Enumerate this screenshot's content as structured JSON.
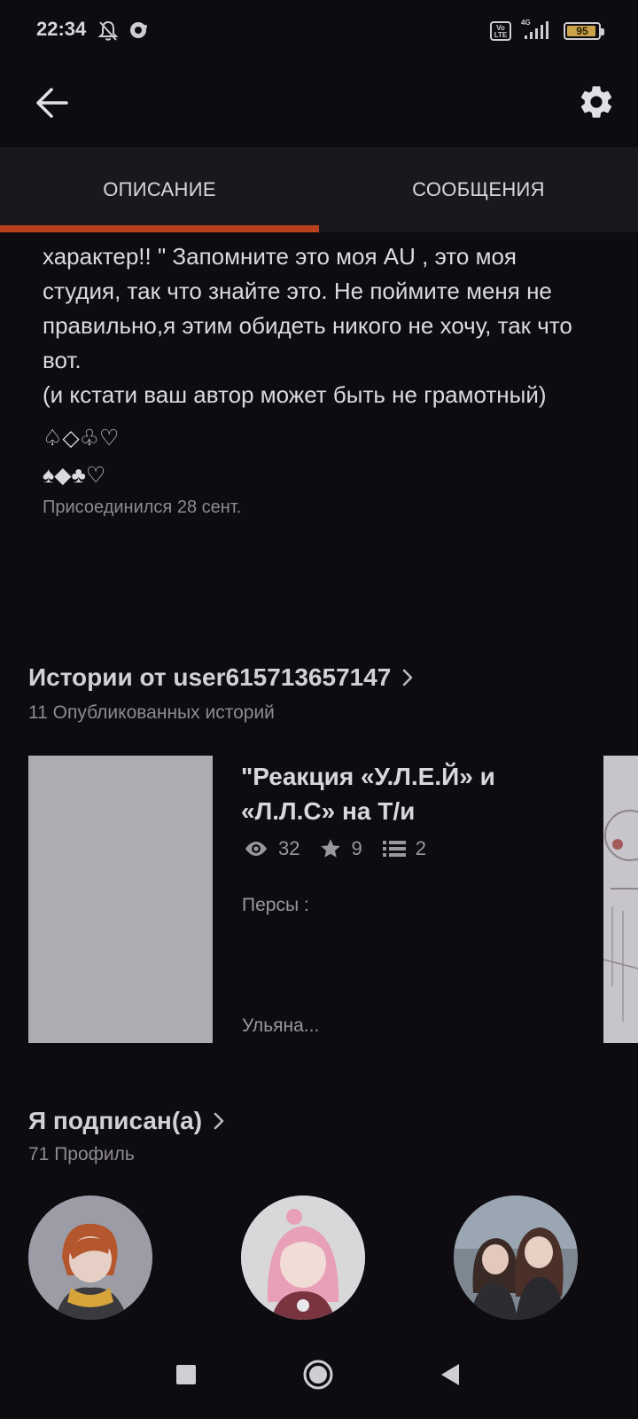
{
  "status_bar": {
    "time": "22:34",
    "battery": "95",
    "battery_level": 0.95,
    "network": "4G",
    "volte": "Vo LTE"
  },
  "toolbar": {
    "back_icon": "arrow-left-icon",
    "settings_icon": "gear-icon"
  },
  "tabs": [
    {
      "label": "ОПИСАНИЕ",
      "active": true
    },
    {
      "label": "СООБЩЕНИЯ",
      "active": false
    }
  ],
  "accent_color": "#b8411c",
  "description": {
    "text": "характер!! \" Запомните это моя AU , это моя студия, так что знайте это. Не поймите меня не правильно,я этим обидеть никого не хочу, так что вот.\n(и кстати ваш автор может быть не грамотный)",
    "suits_outline": "♤◇♧♡",
    "suits_filled": "♠◆♣♡",
    "joined": "Присоединился 28 сент."
  },
  "stories": {
    "title": "Истории от user615713657147",
    "subtitle": "11 Опубликованных историй",
    "items": [
      {
        "title": "\"Реакция «У.Л.Е.Й» и «Л.Л.С» на Т/и",
        "views": "32",
        "stars": "9",
        "parts": "2",
        "excerpt": "Персы :\n\nУльяна..."
      }
    ]
  },
  "following": {
    "title": "Я подписан(а)",
    "subtitle": "71 Профиль"
  },
  "nav_bar": {
    "recents_icon": "square-icon",
    "home_icon": "circle-icon",
    "back_icon": "triangle-back-icon"
  }
}
